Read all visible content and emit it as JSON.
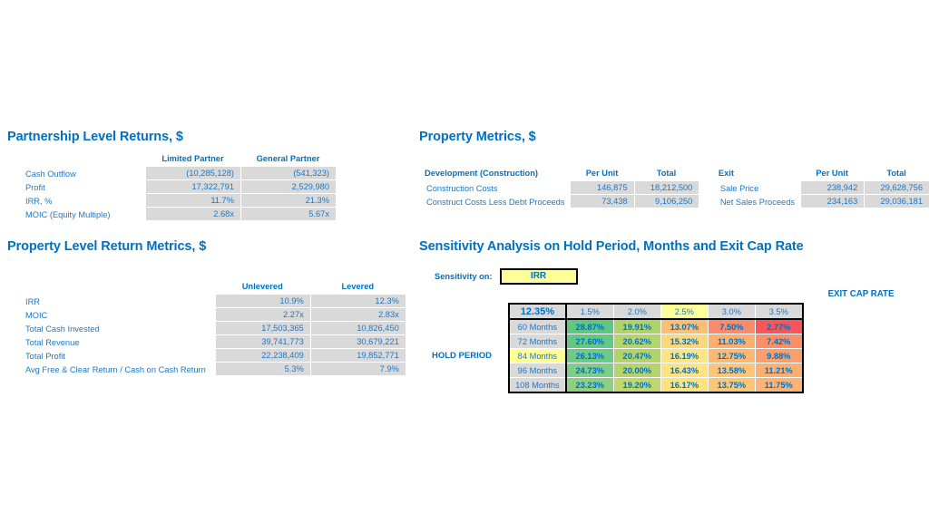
{
  "partnership": {
    "title": "Partnership Level Returns, $",
    "columns": [
      "Limited Partner",
      "General Partner"
    ],
    "rows": [
      {
        "label": "Cash Outflow",
        "values": [
          "(10,285,128)",
          "(541,323)"
        ]
      },
      {
        "label": "Profit",
        "values": [
          "17,322,791",
          "2,529,980"
        ]
      },
      {
        "label": "IRR, %",
        "values": [
          "11.7%",
          "21.3%"
        ]
      },
      {
        "label": "MOIC (Equity Multiple)",
        "values": [
          "2.68x",
          "5.67x"
        ]
      }
    ]
  },
  "property_level_returns": {
    "title": "Property Level Return Metrics, $",
    "columns": [
      "Unlevered",
      "Levered"
    ],
    "rows": [
      {
        "label": "IRR",
        "values": [
          "10.9%",
          "12.3%"
        ]
      },
      {
        "label": "MOIC",
        "values": [
          "2.27x",
          "2.83x"
        ]
      },
      {
        "label": "Total Cash Invested",
        "values": [
          "17,503,365",
          "10,826,450"
        ]
      },
      {
        "label": "Total Revenue",
        "values": [
          "39,741,773",
          "30,679,221"
        ]
      },
      {
        "label": "Total Profit",
        "values": [
          "22,238,409",
          "19,852,771"
        ]
      },
      {
        "label": "Avg Free & Clear Return / Cash on Cash Return",
        "values": [
          "5.3%",
          "7.9%"
        ]
      }
    ]
  },
  "property_metrics": {
    "title": "Property Metrics, $",
    "left_group_header": "Development (Construction)",
    "left_columns": [
      "Per Unit",
      "Total"
    ],
    "right_group_header": "Exit",
    "right_columns": [
      "Per Unit",
      "Total"
    ],
    "rows": [
      {
        "left_label": "Construction Costs",
        "left_values": [
          "146,875",
          "18,212,500"
        ],
        "right_label": "Sale Price",
        "right_values": [
          "238,942",
          "29,628,756"
        ]
      },
      {
        "left_label": "Construct Costs Less Debt Proceeds",
        "left_values": [
          "73,438",
          "9,106,250"
        ],
        "right_label": "Net Sales Proceeds",
        "right_values": [
          "234,163",
          "29,036,181"
        ]
      }
    ]
  },
  "sensitivity": {
    "title": "Sensitivity Analysis on Hold Period, Months and Exit Cap Rate",
    "sensitivity_on_label": "Sensitivity on:",
    "sensitivity_on_value": "IRR",
    "column_axis_title": "EXIT CAP RATE",
    "row_axis_title": "HOLD PERIOD",
    "base_value": "12.35%",
    "highlighted_column": "2.5%",
    "highlighted_row": "84 Months",
    "chart_data": {
      "type": "heatmap",
      "title": "Sensitivity Analysis on Hold Period, Months and Exit Cap Rate",
      "xlabel": "EXIT CAP RATE",
      "ylabel": "HOLD PERIOD",
      "metric": "IRR",
      "base_value": 12.35,
      "categories": [
        "1.5%",
        "2.0%",
        "2.5%",
        "3.0%",
        "3.5%"
      ],
      "rows": [
        "60 Months",
        "72 Months",
        "84 Months",
        "96 Months",
        "108 Months"
      ],
      "values": [
        [
          28.87,
          19.91,
          13.07,
          7.5,
          2.77
        ],
        [
          27.6,
          20.62,
          15.32,
          11.03,
          7.42
        ],
        [
          26.13,
          20.47,
          16.19,
          12.75,
          9.88
        ],
        [
          24.73,
          20.0,
          16.43,
          13.58,
          11.21
        ],
        [
          23.23,
          19.2,
          16.17,
          13.75,
          11.75
        ]
      ],
      "display": [
        [
          "28.87%",
          "19.91%",
          "13.07%",
          "7.50%",
          "2.77%"
        ],
        [
          "27.60%",
          "20.62%",
          "15.32%",
          "11.03%",
          "7.42%"
        ],
        [
          "26.13%",
          "20.47%",
          "16.19%",
          "12.75%",
          "9.88%"
        ],
        [
          "24.73%",
          "20.00%",
          "16.43%",
          "13.58%",
          "11.21%"
        ],
        [
          "23.23%",
          "19.20%",
          "16.17%",
          "13.75%",
          "11.75%"
        ]
      ],
      "cell_colors": [
        [
          "#5FC77F",
          "#AFD36B",
          "#FCBE74",
          "#FB8B6C",
          "#F9565B"
        ],
        [
          "#63C884",
          "#B4D46C",
          "#FCD87C",
          "#FBB070",
          "#FA9069"
        ],
        [
          "#6DCA88",
          "#B2D36B",
          "#FDE585",
          "#FCB974",
          "#FBA06D"
        ],
        [
          "#7ECD88",
          "#B6D46D",
          "#FDE384",
          "#FDC579",
          "#FCAF72"
        ],
        [
          "#8DD07F",
          "#C0D66E",
          "#FDE27F",
          "#FCC677",
          "#FCB374"
        ]
      ]
    }
  },
  "colors": {
    "heading_blue": "#0070C0",
    "text_blue": "#1F77C4",
    "cell_grey": "#D9D9D9",
    "highlight_yellow": "#FFFF99"
  }
}
